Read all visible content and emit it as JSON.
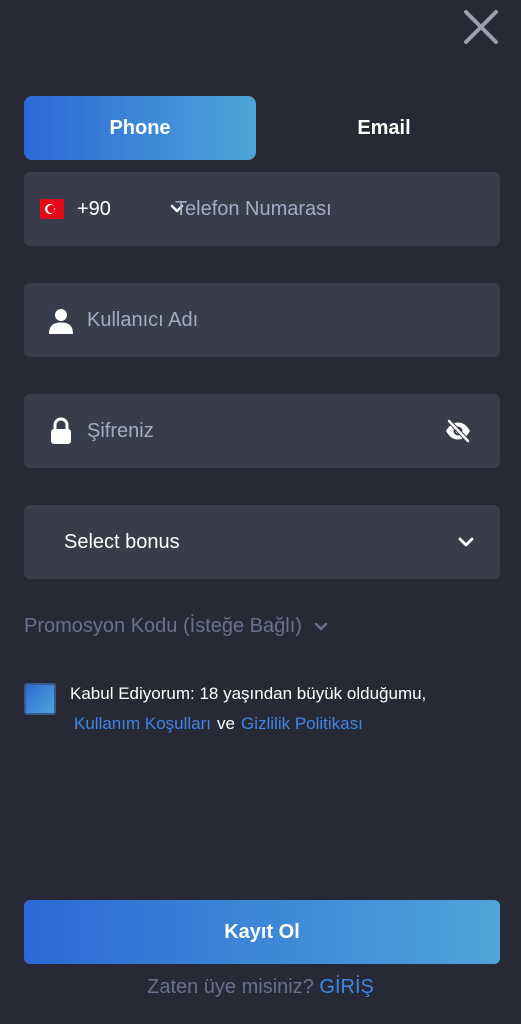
{
  "close": {
    "icon": "close-icon"
  },
  "tabs": [
    {
      "label": "Phone",
      "active": true
    },
    {
      "label": "Email",
      "active": false
    }
  ],
  "phone": {
    "flag_icon": "turkey-flag-icon",
    "country_code": "+90",
    "placeholder": "Telefon Numarası"
  },
  "username": {
    "icon": "user-icon",
    "placeholder": "Kullanıcı Adı"
  },
  "password": {
    "icon": "lock-icon",
    "placeholder": "Şifreniz",
    "toggle_icon": "eye-slash-icon"
  },
  "bonus": {
    "selected": "Select bonus"
  },
  "promo": {
    "label": "Promosyon Kodu (İsteğe Bağlı)"
  },
  "terms": {
    "text": "Kabul Ediyorum: 18 yaşından büyük olduğumu,",
    "terms_link": "Kullanım Koşulları",
    "and": "ve",
    "privacy_link": "Gizlilik Politikası"
  },
  "submit": {
    "label": "Kayıt Ol"
  },
  "footer": {
    "question": "Zaten üye misiniz?",
    "login_link": "GİRİŞ"
  },
  "colors": {
    "background": "#272a36",
    "field": "#393d4b",
    "accent_start": "#2b6ad6",
    "accent_end": "#4fa4d8",
    "link": "#3f86e6",
    "muted": "#6a7190"
  }
}
